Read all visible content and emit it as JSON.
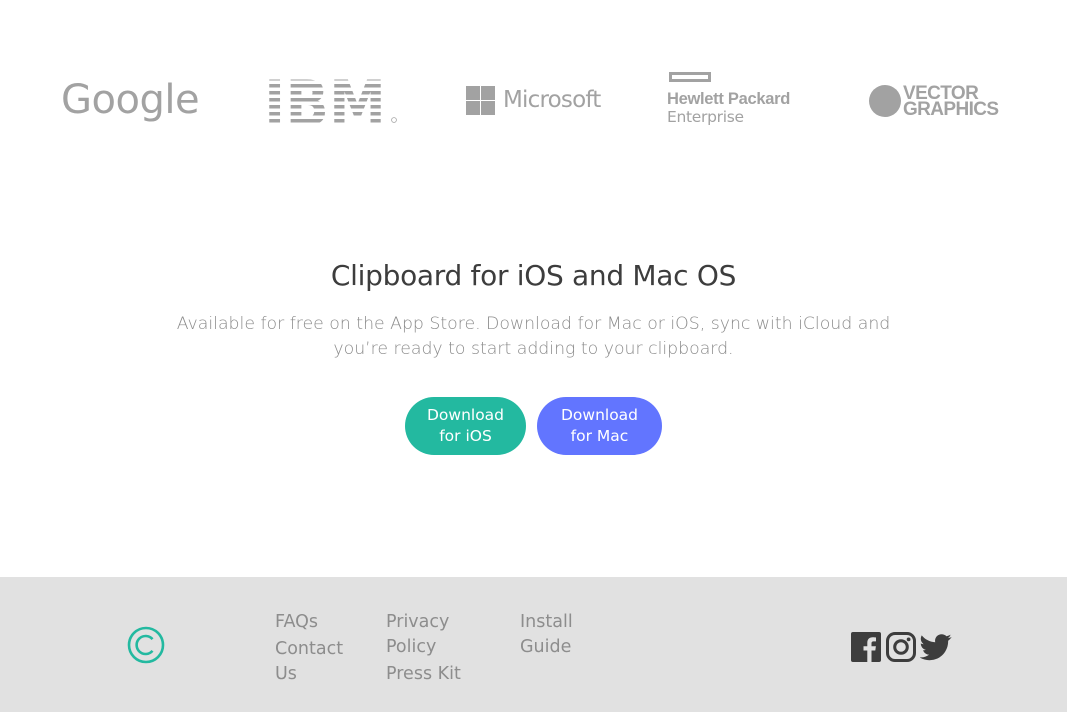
{
  "logos": {
    "google": "Google",
    "ibm": "IBM",
    "microsoft": "Microsoft",
    "hpe_line1": "Hewlett Packard",
    "hpe_line2": "Enterprise",
    "vector_line1": "VECTOR",
    "vector_line2": "GRAPHICS"
  },
  "hero": {
    "title": "Clipboard for iOS and Mac OS",
    "description": "Available for free on the App Store. Download for Mac or iOS, sync with iCloud and you’re ready to start adding to your clipboard.",
    "button_ios": "Download for iOS",
    "button_mac": "Download for Mac"
  },
  "footer": {
    "links_col1": [
      "FAQs",
      "Contact Us"
    ],
    "links_col2": [
      "Privacy Policy",
      "Press Kit"
    ],
    "links_col3": [
      "Install Guide"
    ],
    "social": [
      "facebook-icon",
      "instagram-icon",
      "twitter-icon"
    ]
  },
  "colors": {
    "accent_teal": "#23b9a0",
    "accent_blue": "#6275ff",
    "logo_gray": "#a2a2a2",
    "footer_bg": "#e1e1e1"
  }
}
